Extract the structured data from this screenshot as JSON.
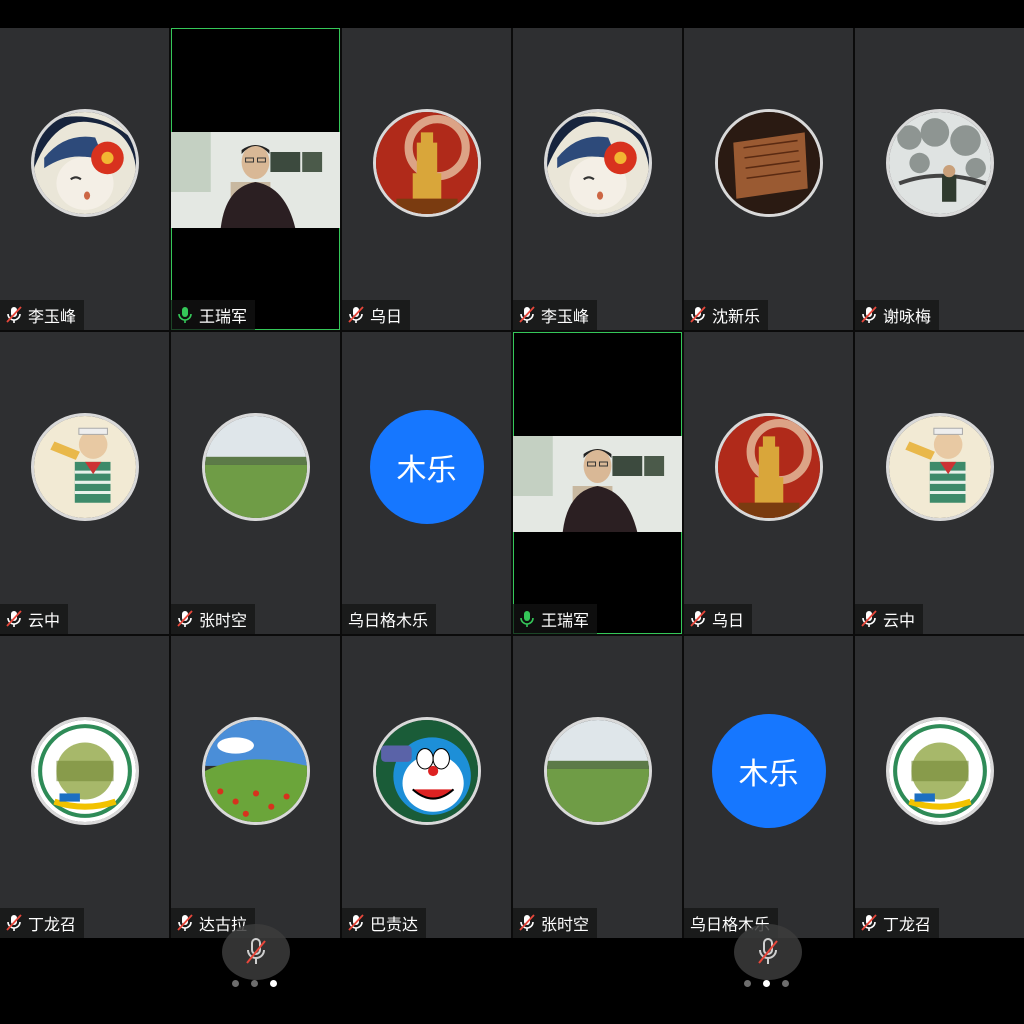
{
  "colors": {
    "mic_on": "#35c759",
    "mic_off": "#e8473b",
    "tile_bg": "#2e2f31",
    "text_avatar": "#1677ff"
  },
  "tiles": [
    {
      "name": "李玉峰",
      "mic": "muted",
      "avatar": "anime-girl-flower"
    },
    {
      "name": "王瑞军",
      "mic": "on",
      "avatar": "video"
    },
    {
      "name": "乌日",
      "mic": "muted",
      "avatar": "golden-statue"
    },
    {
      "name": "李玉峰",
      "mic": "muted",
      "avatar": "anime-girl-flower"
    },
    {
      "name": "沈新乐",
      "mic": "muted",
      "avatar": "old-book"
    },
    {
      "name": "谢咏梅",
      "mic": "muted",
      "avatar": "snowy-tree"
    },
    {
      "name": "云中",
      "mic": "muted",
      "avatar": "cartoon-boy-drinking"
    },
    {
      "name": "张时空",
      "mic": "muted",
      "avatar": "grassland"
    },
    {
      "name": "乌日格木乐",
      "mic": "none",
      "avatar": "text",
      "avatar_text": "木乐"
    },
    {
      "name": "王瑞军",
      "mic": "on",
      "avatar": "video"
    },
    {
      "name": "乌日",
      "mic": "muted",
      "avatar": "golden-statue"
    },
    {
      "name": "云中",
      "mic": "muted",
      "avatar": "cartoon-boy-drinking"
    },
    {
      "name": "丁龙召",
      "mic": "muted",
      "avatar": "school-emblem"
    },
    {
      "name": "达古拉",
      "mic": "muted",
      "avatar": "flower-field"
    },
    {
      "name": "巴责达",
      "mic": "muted",
      "avatar": "doraemon"
    },
    {
      "name": "张时空",
      "mic": "muted",
      "avatar": "grassland"
    },
    {
      "name": "乌日格木乐",
      "mic": "none",
      "avatar": "text",
      "avatar_text": "木乐"
    },
    {
      "name": "丁龙召",
      "mic": "muted",
      "avatar": "school-emblem"
    }
  ],
  "pagers": [
    {
      "dots": 3,
      "active": 2
    },
    {
      "dots": 3,
      "active": 1
    }
  ]
}
